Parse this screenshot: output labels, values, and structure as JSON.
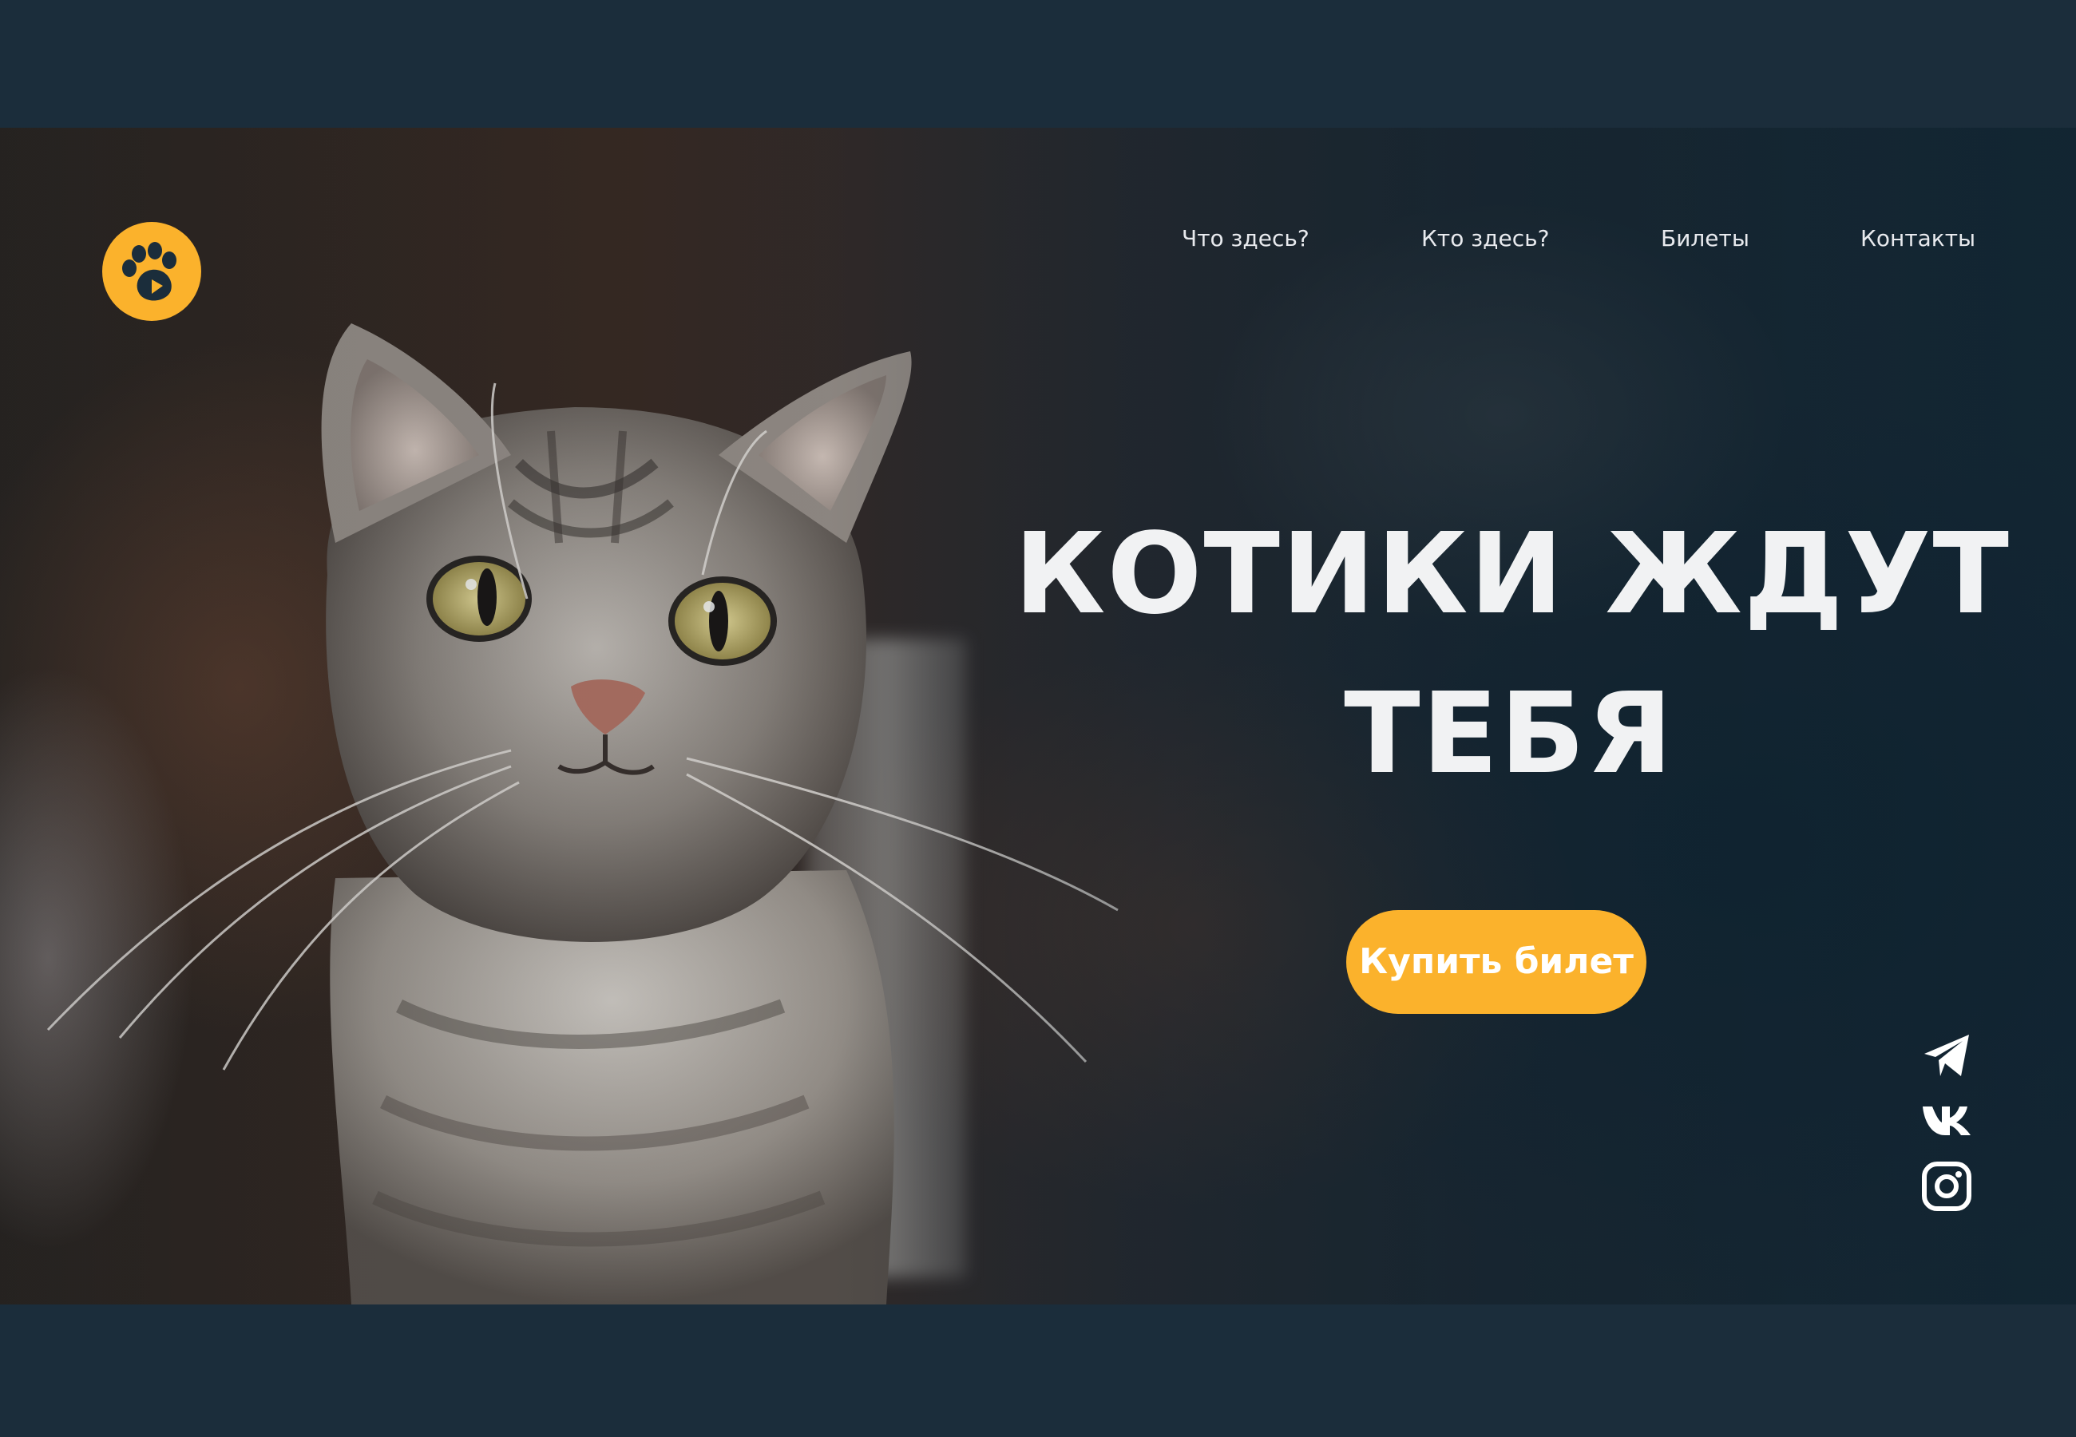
{
  "nav": {
    "items": [
      {
        "label": "Что здесь?"
      },
      {
        "label": "Кто здесь?"
      },
      {
        "label": "Билеты"
      },
      {
        "label": "Контакты"
      }
    ]
  },
  "hero": {
    "title_line1": "КОТИКИ ЖДУТ",
    "title_line2": "ТЕБЯ",
    "cta_label": "Купить билет"
  },
  "social": [
    {
      "icon": "telegram-icon"
    },
    {
      "icon": "vk-icon"
    },
    {
      "icon": "instagram-icon"
    }
  ],
  "colors": {
    "accent": "#fbb22c",
    "background": "#1b2d3b",
    "text": "#f1f2f3",
    "logo_paw": "#1b2d3b"
  }
}
